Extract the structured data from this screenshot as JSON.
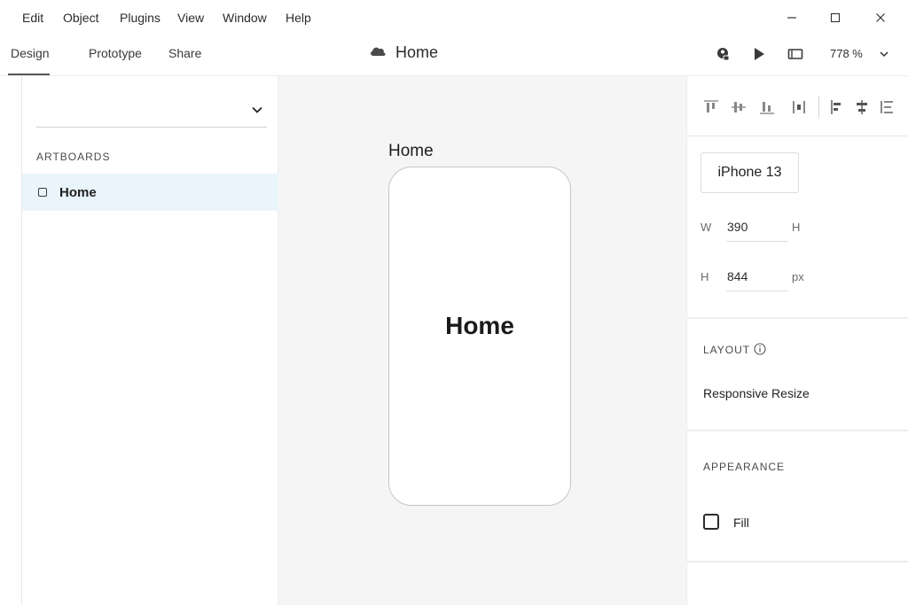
{
  "menubar": {
    "items": [
      "Edit",
      "Object",
      "Plugins",
      "View",
      "Window",
      "Help"
    ],
    "window_controls": [
      "minimize-icon",
      "maximize-icon",
      "close-icon"
    ]
  },
  "tabs": {
    "items": [
      "Design",
      "Prototype",
      "Share"
    ],
    "active": "Design"
  },
  "document": {
    "title": "Home",
    "cloud_icon": "cloud-icon"
  },
  "toolbar": {
    "icons": [
      "user-share-icon",
      "play-icon",
      "preview-device-icon"
    ],
    "zoom": "778 %",
    "zoom_dropdown_icon": "chevron-down-icon"
  },
  "left_panel": {
    "section_label": "ARTBOARDS",
    "artboards": [
      {
        "name": "Home",
        "selected": true
      }
    ]
  },
  "canvas": {
    "artboard_label": "Home",
    "artboard_text": "Home"
  },
  "right_panel": {
    "align_icons": [
      "align-top-icon",
      "align-middle-icon",
      "align-bottom-icon",
      "distribute-horizontal-icon",
      "align-left-icon",
      "align-center-icon",
      "distribute-vertical-icon"
    ],
    "device": "iPhone 13",
    "width_label": "W",
    "width_value": "390",
    "width_suffix": "H",
    "height_label": "H",
    "height_value": "844",
    "height_suffix": "px",
    "layout_label": "LAYOUT",
    "layout_option": "Responsive Resize",
    "appearance_label": "APPEARANCE",
    "fill_label": "Fill",
    "fill_checked": false
  },
  "colors": {
    "canvas_bg": "#f5f5f5",
    "selected_row": "#e9f5fb",
    "text": "#2c2c2c"
  }
}
